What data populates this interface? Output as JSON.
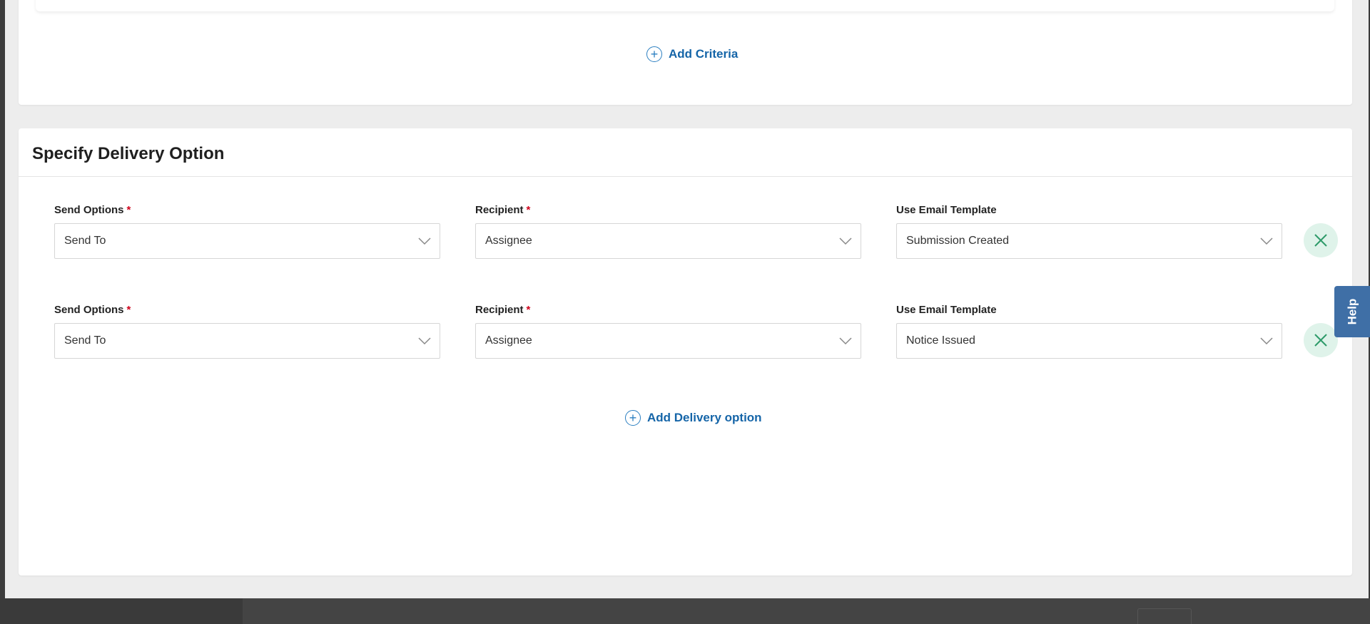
{
  "criteria": {
    "add_label": "Add Criteria"
  },
  "delivery": {
    "title": "Specify Delivery Option",
    "rows": [
      {
        "send_options": {
          "label": "Send Options",
          "required": "*",
          "value": "Send To"
        },
        "recipient": {
          "label": "Recipient",
          "required": "*",
          "value": "Assignee"
        },
        "template": {
          "label": "Use Email Template",
          "value": "Submission Created"
        }
      },
      {
        "send_options": {
          "label": "Send Options",
          "required": "*",
          "value": "Send To"
        },
        "recipient": {
          "label": "Recipient",
          "required": "*",
          "value": "Assignee"
        },
        "template": {
          "label": "Use Email Template",
          "value": "Notice Issued"
        }
      }
    ],
    "add_label": "Add Delivery option"
  },
  "help": {
    "label": "Help"
  },
  "icons": {
    "add": "plus-circle-icon",
    "remove": "close-icon",
    "dropdown": "chevron-down-icon"
  },
  "colors": {
    "link": "#1565a8",
    "required": "#d0021b",
    "remove_bg": "#dff3ea",
    "remove_icon": "#2e9b6a",
    "help_bg": "#3f6fa6"
  }
}
